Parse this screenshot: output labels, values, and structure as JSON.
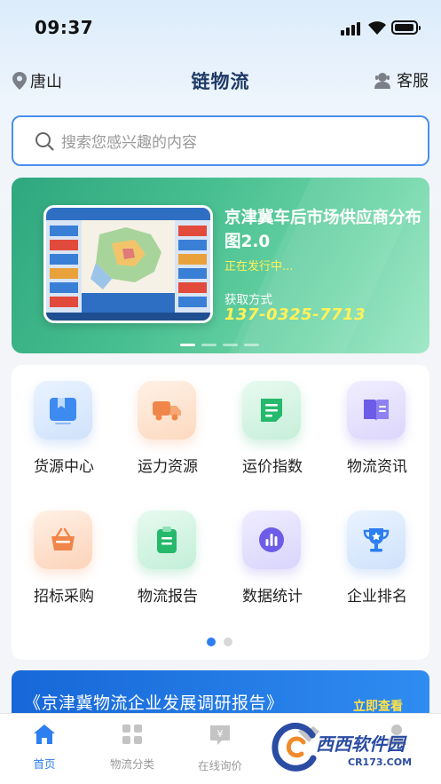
{
  "status": {
    "time": "09:37"
  },
  "header": {
    "location": "唐山",
    "title": "链物流",
    "service": "客服"
  },
  "search": {
    "placeholder": "搜索您感兴趣的内容"
  },
  "banner": {
    "title": "京津冀车后市场供应商分布图2.0",
    "status": "正在发行中...",
    "get_label": "获取方式",
    "phone": "137-0325-7713",
    "page_count": 4,
    "active_page": 1
  },
  "grid": {
    "items": [
      {
        "label": "货源中心",
        "icon": "cargo-icon"
      },
      {
        "label": "运力资源",
        "icon": "truck-icon"
      },
      {
        "label": "运价指数",
        "icon": "doc-icon"
      },
      {
        "label": "物流资讯",
        "icon": "book-icon"
      },
      {
        "label": "招标采购",
        "icon": "basket-icon"
      },
      {
        "label": "物流报告",
        "icon": "clipboard-icon"
      },
      {
        "label": "数据统计",
        "icon": "stats-icon"
      },
      {
        "label": "企业排名",
        "icon": "trophy-icon"
      }
    ],
    "page_count": 2,
    "active_page": 1
  },
  "report": {
    "title": "《京津冀物流企业发展调研报告》",
    "link": "立即查看"
  },
  "tabbar": {
    "items": [
      {
        "label": "首页",
        "icon": "home-icon",
        "active": true
      },
      {
        "label": "物流分类",
        "icon": "category-icon"
      },
      {
        "label": "在线询价",
        "icon": "price-icon"
      },
      {
        "label": "",
        "icon": "handshake-icon"
      },
      {
        "label": "",
        "icon": "profile-icon"
      }
    ]
  },
  "watermark": {
    "text": "西西软件园",
    "sub": "CR173.COM"
  },
  "colors": {
    "accent": "#2d7ef0",
    "banner": "#48bf90",
    "highlight": "#fff25a"
  }
}
